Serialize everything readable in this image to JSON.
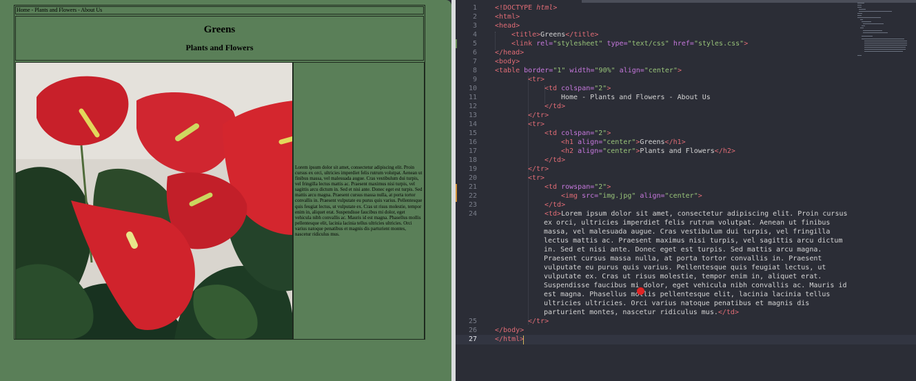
{
  "preview": {
    "nav_text": "Home - Plants and Flowers - About Us",
    "h1": "Greens",
    "h2": "Plants and Flowers",
    "paragraph": "Lorem ipsum dolor sit amet, consectetur adipiscing elit. Proin cursus ex orci, ultricies imperdiet felis rutrum volutpat. Aenean ut finibus massa, vel malesuada augue. Cras vestibulum dui turpis, vel fringilla lectus mattis ac. Praesent maximus nisi turpis, vel sagittis arcu dictum in. Sed et nisi ante. Donec eget est turpis. Sed mattis arcu magna. Praesent cursus massa nulla, at porta tortor convallis in. Praesent vulputate eu purus quis varius. Pellentesque quis feugiat lectus, ut vulputate ex. Cras ut risus molestie, tempor enim in, aliquet erat. Suspendisse faucibus mi dolor, eget vehicula nibh convallis ac. Mauris id est magna. Phasellus mollis pellentesque elit, lacinia lacinia tellus ultricies ultricies. Orci varius natoque penatibus et magnis dis parturient montes, nascetur ridiculus mus.",
    "image_subject": "red anthurium flowers"
  },
  "editor": {
    "active_line": 27,
    "line_numbers": [
      "1",
      "2",
      "3",
      "4",
      "5",
      "6",
      "7",
      "8",
      "9",
      "10",
      "11",
      "12",
      "13",
      "14",
      "15",
      "16",
      "17",
      "18",
      "19",
      "20",
      "21",
      "22",
      "23",
      "24",
      "25",
      "26",
      "27"
    ],
    "code": {
      "l1_kw": "<!DOCTYPE ",
      "l1_html": "html",
      "l1_end": ">",
      "l2": "<html>",
      "l3": "<head>",
      "l4_open": "<title>",
      "l4_text": "Greens",
      "l4_close": "</title>",
      "l5_tag": "<link ",
      "l5_a1": "rel=",
      "l5_v1": "\"stylesheet\"",
      "l5_a2": " type=",
      "l5_v2": "\"text/css\"",
      "l5_a3": " href=",
      "l5_v3": "\"styles.css\"",
      "l5_end": ">",
      "l6": "</head>",
      "l7": "<body>",
      "l8_tag": "<table ",
      "l8_a1": "border=",
      "l8_v1": "\"1\"",
      "l8_a2": " width=",
      "l8_v2": "\"90%\"",
      "l8_a3": " align=",
      "l8_v3": "\"center\"",
      "l8_end": ">",
      "tr_open": "<tr>",
      "tr_close": "</tr>",
      "td_colspan_tag": "<td ",
      "colspan_attr": "colspan=",
      "colspan_val": "\"2\"",
      "gt": ">",
      "td_close": "</td>",
      "l11": "Home - Plants and Flowers - About Us",
      "l16_tag": "<h1 ",
      "align_attr": "align=",
      "center_val": "\"center\"",
      "l16_text": "Greens",
      "l16_close": "</h1>",
      "l17_tag": "<h2 ",
      "l17_text": "Plants and Flowers",
      "l17_close": "</h2>",
      "l21_attr": "rowspan=",
      "l22_tag": "<img ",
      "l22_a1": "src=",
      "l22_v1": "\"img.jpg\"",
      "l22_a2": " align=",
      "l24_open": "<td>",
      "l24_lines": [
        "Lorem ipsum dolor sit amet, consectetur adipiscing elit. Proin cursus",
        "ex orci, ultricies imperdiet felis rutrum volutpat. Aenean ut finibus",
        "massa, vel malesuada augue. Cras vestibulum dui turpis, vel fringilla",
        "lectus mattis ac. Praesent maximus nisi turpis, vel sagittis arcu dictum",
        "in. Sed et nisi ante. Donec eget est turpis. Sed mattis arcu magna.",
        "Praesent cursus massa nulla, at porta tortor convallis in. Praesent",
        "vulputate eu purus quis varius. Pellentesque quis feugiat lectus, ut",
        "vulputate ex. Cras ut risus molestie, tempor enim in, aliquet erat.",
        "Suspendisse faucibus mi dolor, eget vehicula nibh convallis ac. Mauris id",
        "est magna. Phasellus mollis pellentesque elit, lacinia lacinia tellus",
        "ultricies ultricies. Orci varius natoque penatibus et magnis dis",
        "parturient montes, nascetur ridiculus mus."
      ],
      "l26": "</body>",
      "l27": "</html>"
    }
  }
}
